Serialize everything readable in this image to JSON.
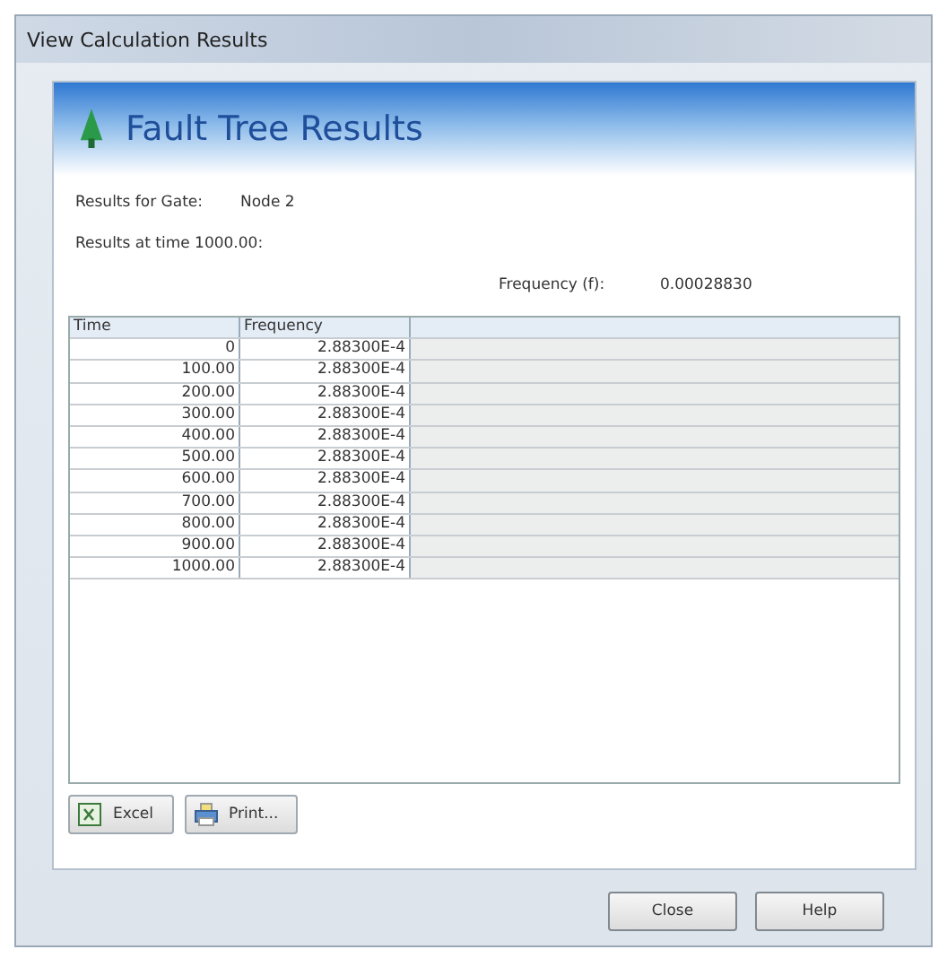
{
  "window": {
    "title": "View Calculation Results"
  },
  "header": {
    "title": "Fault Tree Results"
  },
  "gate": {
    "label": "Results for Gate:",
    "value": "Node 2"
  },
  "time_label": "Results at time 1000.00:",
  "frequency": {
    "label": "Frequency (f):",
    "value": "0.00028830"
  },
  "table": {
    "columns": [
      "Time",
      "Frequency"
    ],
    "rows": [
      [
        "0",
        "2.88300E-4"
      ],
      [
        "100.00",
        "2.88300E-4"
      ],
      [
        "200.00",
        "2.88300E-4"
      ],
      [
        "300.00",
        "2.88300E-4"
      ],
      [
        "400.00",
        "2.88300E-4"
      ],
      [
        "500.00",
        "2.88300E-4"
      ],
      [
        "600.00",
        "2.88300E-4"
      ],
      [
        "700.00",
        "2.88300E-4"
      ],
      [
        "800.00",
        "2.88300E-4"
      ],
      [
        "900.00",
        "2.88300E-4"
      ],
      [
        "1000.00",
        "2.88300E-4"
      ]
    ]
  },
  "export_buttons": [
    {
      "label": "Excel",
      "kind": "excel"
    },
    {
      "label": "Print...",
      "kind": "print"
    }
  ],
  "dialog_buttons": [
    "Close",
    "Help"
  ]
}
